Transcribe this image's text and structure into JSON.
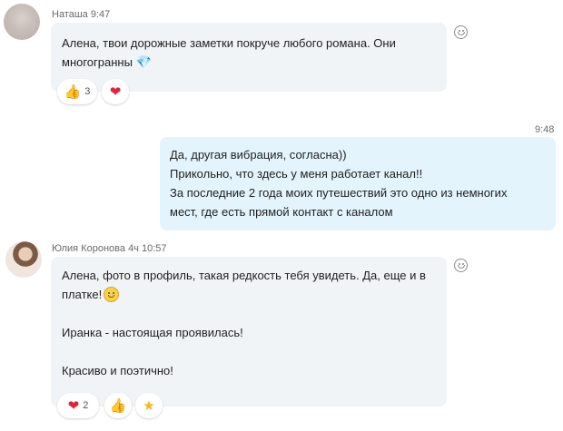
{
  "colors": {
    "incoming_bubble": "#f1f4f7",
    "outgoing_bubble": "#e3f4fd",
    "heart": "#e0243a",
    "meta_text": "#6a6a6a"
  },
  "messages": [
    {
      "sender": "Наташа",
      "time": "9:47",
      "lines": [
        "Алена, твои дорожные заметки покруче любого романа. Они",
        "многогранны"
      ],
      "inline_icon": "gem-icon",
      "reactions": [
        {
          "icon": "thumbs-up-icon",
          "count": "3"
        },
        {
          "icon": "heart-icon",
          "count": ""
        }
      ]
    },
    {
      "direction": "outgoing",
      "time": "9:48",
      "lines": [
        "Да, другая вибрация, согласна))",
        "Прикольно, что здесь у меня работает канал!!",
        "За последние 2 года моих путешествий это одно из немногих",
        "мест, где есть прямой контакт с каналом"
      ]
    },
    {
      "sender": "Юлия Коронова",
      "time": "4ч 10:57",
      "lines": [
        "Алена, фото в профиль, такая редкость тебя увидеть. Да, еще и в",
        "платке!",
        "Иранка - настоящая проявилась!",
        "Красиво и поэтично!"
      ],
      "inline_icon": "smiley-icon",
      "reactions": [
        {
          "icon": "heart-icon",
          "count": "2"
        },
        {
          "icon": "thumbs-up-icon",
          "count": ""
        },
        {
          "icon": "star-icon",
          "count": ""
        }
      ]
    }
  ]
}
